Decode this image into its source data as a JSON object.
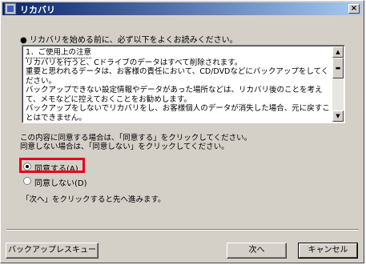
{
  "window": {
    "title": "リカバリ",
    "close_glyph": "×"
  },
  "intro": "● リカバリを始める前に、必ず以下をよくお読みください。",
  "notice": {
    "title": "1．ご使用上の注意",
    "body": "リカバリを行うと、Cドライブのデータはすべて削除されます。\n重要と思われるデータは、お客様の責任において、CD/DVDなどにバックアップをしてください。\nバックアップできない設定情報やデータがあった場所などは、リカバリ後のことを考えて、メモなどに控えておくことをお勧めします。\nバックアップをしないでリカバリをし、お客様個人のデータが消失した場合、元に戻すことはできません。"
  },
  "consent": {
    "line1": "この内容に同意する場合は、「同意する」をクリックしてください。",
    "line2": "同意しない場合は、「同意しない」をクリックしてください。"
  },
  "options": [
    {
      "label": "同意する(A)",
      "checked": true
    },
    {
      "label": "同意しない(D)",
      "checked": false
    }
  ],
  "next_hint": "「次へ」をクリックすると先へ進みます。",
  "buttons": {
    "backup": "バックアップレスキュー",
    "next": "次へ",
    "cancel": "キャンセル"
  },
  "colors": {
    "highlight": "#e8001a",
    "title_bar": "#0a246a",
    "face": "#d4d0c8"
  },
  "icons": {
    "scroll_up": "▲",
    "scroll_down": "▼",
    "scroll_thumb": "▬"
  }
}
